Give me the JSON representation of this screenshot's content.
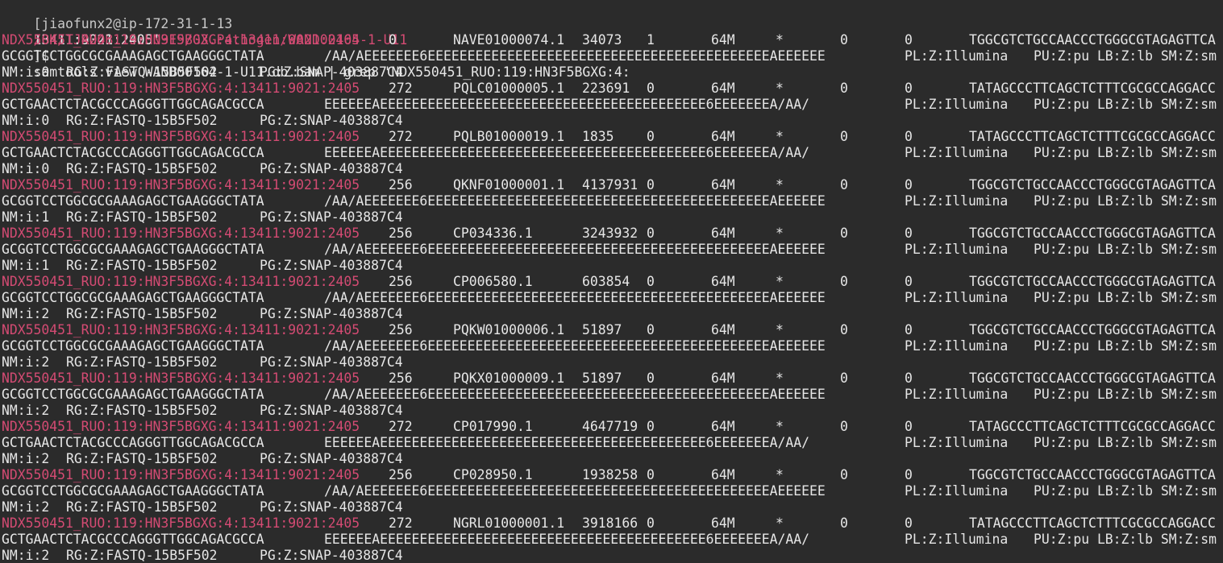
{
  "prompt": {
    "user_host": "[jiaofunx2@ip-172-31-1-13",
    "path": "/BK/TJ424B_20200919/03.Pathogen/WAND00164-1-U11",
    "suffix": "]$",
    "command_line1": "samtools view WAND00164-1-U11.db.bam | grep 'NDX550451_RUO:119:HN3F5BGXG:4:",
    "command_line2": "13411:9021:2405'"
  },
  "colors": {
    "background": "#2b2b2b",
    "text": "#e6e6e6",
    "qname": "#d44b73"
  },
  "records": [
    {
      "qname": "NDX550451_RUO:119:HN3F5BGXG:4:13411:9021:2405",
      "flag": "0",
      "rname": "NAVE01000074.1",
      "pos": "34073",
      "mapq": "1",
      "cigar": "64M",
      "rnext": "*",
      "pnext": "0",
      "tlen": "0",
      "seq_start": "TGGCGTCTGCCAACCCTGGGCGTAGAGTTCA",
      "seq_end": "GCGGTCCTGGCGCGAAAGAGCTGAAGGGCTATA",
      "qual": "/AA/AEEEEEEE6EEEEEEEEEEEEEEEEEEEEEEEEEEEEEEEEEEEEEEEEEEEAEEEEEE",
      "pl": "PL:Z:Illumina",
      "pu_lb_sm": "PU:Z:pu LB:Z:lb SM:Z:sm",
      "nm": "NM:i:0",
      "rg": "RG:Z:FASTQ-15B5F502",
      "pg": "PG:Z:SNAP-403887C4"
    },
    {
      "qname": "NDX550451_RUO:119:HN3F5BGXG:4:13411:9021:2405",
      "flag": "272",
      "rname": "PQLC01000005.1",
      "pos": "223691",
      "mapq": "0",
      "cigar": "64M",
      "rnext": "*",
      "pnext": "0",
      "tlen": "0",
      "seq_start": "TATAGCCCTTCAGCTCTTTCGCGCCAGGACC",
      "seq_end": "GCTGAACTCTACGCCCAGGGTTGGCAGACGCCA",
      "qual": "EEEEEEAEEEEEEEEEEEEEEEEEEEEEEEEEEEEEEEEEEEEEEEEE6EEEEEEEA/AA/",
      "pl": "PL:Z:Illumina",
      "pu_lb_sm": "PU:Z:pu LB:Z:lb SM:Z:sm",
      "nm": "NM:i:0",
      "rg": "RG:Z:FASTQ-15B5F502",
      "pg": "PG:Z:SNAP-403887C4"
    },
    {
      "qname": "NDX550451_RUO:119:HN3F5BGXG:4:13411:9021:2405",
      "flag": "272",
      "rname": "PQLB01000019.1",
      "pos": "1835",
      "mapq": "0",
      "cigar": "64M",
      "rnext": "*",
      "pnext": "0",
      "tlen": "0",
      "seq_start": "TATAGCCCTTCAGCTCTTTCGCGCCAGGACC",
      "seq_end": "GCTGAACTCTACGCCCAGGGTTGGCAGACGCCA",
      "qual": "EEEEEEAEEEEEEEEEEEEEEEEEEEEEEEEEEEEEEEEEEEEEEEEE6EEEEEEEA/AA/",
      "pl": "PL:Z:Illumina",
      "pu_lb_sm": "PU:Z:pu LB:Z:lb SM:Z:sm",
      "nm": "NM:i:0",
      "rg": "RG:Z:FASTQ-15B5F502",
      "pg": "PG:Z:SNAP-403887C4"
    },
    {
      "qname": "NDX550451_RUO:119:HN3F5BGXG:4:13411:9021:2405",
      "flag": "256",
      "rname": "QKNF01000001.1",
      "pos": "4137931",
      "mapq": "0",
      "cigar": "64M",
      "rnext": "*",
      "pnext": "0",
      "tlen": "0",
      "seq_start": "TGGCGTCTGCCAACCCTGGGCGTAGAGTTCA",
      "seq_end": "GCGGTCCTGGCGCGAAAGAGCTGAAGGGCTATA",
      "qual": "/AA/AEEEEEEE6EEEEEEEEEEEEEEEEEEEEEEEEEEEEEEEEEEEEEEEEEEEAEEEEEE",
      "pl": "PL:Z:Illumina",
      "pu_lb_sm": "PU:Z:pu LB:Z:lb SM:Z:sm",
      "nm": "NM:i:1",
      "rg": "RG:Z:FASTQ-15B5F502",
      "pg": "PG:Z:SNAP-403887C4"
    },
    {
      "qname": "NDX550451_RUO:119:HN3F5BGXG:4:13411:9021:2405",
      "flag": "256",
      "rname": "CP034336.1",
      "pos": "3243932",
      "mapq": "0",
      "cigar": "64M",
      "rnext": "*",
      "pnext": "0",
      "tlen": "0",
      "seq_start": "TGGCGTCTGCCAACCCTGGGCGTAGAGTTCA",
      "seq_end": "GCGGTCCTGGCGCGAAAGAGCTGAAGGGCTATA",
      "qual": "/AA/AEEEEEEE6EEEEEEEEEEEEEEEEEEEEEEEEEEEEEEEEEEEEEEEEEEEAEEEEEE",
      "pl": "PL:Z:Illumina",
      "pu_lb_sm": "PU:Z:pu LB:Z:lb SM:Z:sm",
      "nm": "NM:i:1",
      "rg": "RG:Z:FASTQ-15B5F502",
      "pg": "PG:Z:SNAP-403887C4"
    },
    {
      "qname": "NDX550451_RUO:119:HN3F5BGXG:4:13411:9021:2405",
      "flag": "256",
      "rname": "CP006580.1",
      "pos": "603854",
      "mapq": "0",
      "cigar": "64M",
      "rnext": "*",
      "pnext": "0",
      "tlen": "0",
      "seq_start": "TGGCGTCTGCCAACCCTGGGCGTAGAGTTCA",
      "seq_end": "GCGGTCCTGGCGCGAAAGAGCTGAAGGGCTATA",
      "qual": "/AA/AEEEEEEE6EEEEEEEEEEEEEEEEEEEEEEEEEEEEEEEEEEEEEEEEEEEAEEEEEE",
      "pl": "PL:Z:Illumina",
      "pu_lb_sm": "PU:Z:pu LB:Z:lb SM:Z:sm",
      "nm": "NM:i:2",
      "rg": "RG:Z:FASTQ-15B5F502",
      "pg": "PG:Z:SNAP-403887C4"
    },
    {
      "qname": "NDX550451_RUO:119:HN3F5BGXG:4:13411:9021:2405",
      "flag": "256",
      "rname": "PQKW01000006.1",
      "pos": "51897",
      "mapq": "0",
      "cigar": "64M",
      "rnext": "*",
      "pnext": "0",
      "tlen": "0",
      "seq_start": "TGGCGTCTGCCAACCCTGGGCGTAGAGTTCA",
      "seq_end": "GCGGTCCTGGCGCGAAAGAGCTGAAGGGCTATA",
      "qual": "/AA/AEEEEEEE6EEEEEEEEEEEEEEEEEEEEEEEEEEEEEEEEEEEEEEEEEEEAEEEEEE",
      "pl": "PL:Z:Illumina",
      "pu_lb_sm": "PU:Z:pu LB:Z:lb SM:Z:sm",
      "nm": "NM:i:2",
      "rg": "RG:Z:FASTQ-15B5F502",
      "pg": "PG:Z:SNAP-403887C4"
    },
    {
      "qname": "NDX550451_RUO:119:HN3F5BGXG:4:13411:9021:2405",
      "flag": "256",
      "rname": "PQKX01000009.1",
      "pos": "51897",
      "mapq": "0",
      "cigar": "64M",
      "rnext": "*",
      "pnext": "0",
      "tlen": "0",
      "seq_start": "TGGCGTCTGCCAACCCTGGGCGTAGAGTTCA",
      "seq_end": "GCGGTCCTGGCGCGAAAGAGCTGAAGGGCTATA",
      "qual": "/AA/AEEEEEEE6EEEEEEEEEEEEEEEEEEEEEEEEEEEEEEEEEEEEEEEEEEEAEEEEEE",
      "pl": "PL:Z:Illumina",
      "pu_lb_sm": "PU:Z:pu LB:Z:lb SM:Z:sm",
      "nm": "NM:i:2",
      "rg": "RG:Z:FASTQ-15B5F502",
      "pg": "PG:Z:SNAP-403887C4"
    },
    {
      "qname": "NDX550451_RUO:119:HN3F5BGXG:4:13411:9021:2405",
      "flag": "272",
      "rname": "CP017990.1",
      "pos": "4647719",
      "mapq": "0",
      "cigar": "64M",
      "rnext": "*",
      "pnext": "0",
      "tlen": "0",
      "seq_start": "TATAGCCCTTCAGCTCTTTCGCGCCAGGACC",
      "seq_end": "GCTGAACTCTACGCCCAGGGTTGGCAGACGCCA",
      "qual": "EEEEEEAEEEEEEEEEEEEEEEEEEEEEEEEEEEEEEEEEEEEEEEEE6EEEEEEEA/AA/",
      "pl": "PL:Z:Illumina",
      "pu_lb_sm": "PU:Z:pu LB:Z:lb SM:Z:sm",
      "nm": "NM:i:2",
      "rg": "RG:Z:FASTQ-15B5F502",
      "pg": "PG:Z:SNAP-403887C4"
    },
    {
      "qname": "NDX550451_RUO:119:HN3F5BGXG:4:13411:9021:2405",
      "flag": "256",
      "rname": "CP028950.1",
      "pos": "1938258",
      "mapq": "0",
      "cigar": "64M",
      "rnext": "*",
      "pnext": "0",
      "tlen": "0",
      "seq_start": "TGGCGTCTGCCAACCCTGGGCGTAGAGTTCA",
      "seq_end": "GCGGTCCTGGCGCGAAAGAGCTGAAGGGCTATA",
      "qual": "/AA/AEEEEEEE6EEEEEEEEEEEEEEEEEEEEEEEEEEEEEEEEEEEEEEEEEEEAEEEEEE",
      "pl": "PL:Z:Illumina",
      "pu_lb_sm": "PU:Z:pu LB:Z:lb SM:Z:sm",
      "nm": "NM:i:2",
      "rg": "RG:Z:FASTQ-15B5F502",
      "pg": "PG:Z:SNAP-403887C4"
    },
    {
      "qname": "NDX550451_RUO:119:HN3F5BGXG:4:13411:9021:2405",
      "flag": "272",
      "rname": "NGRL01000001.1",
      "pos": "3918166",
      "mapq": "0",
      "cigar": "64M",
      "rnext": "*",
      "pnext": "0",
      "tlen": "0",
      "seq_start": "TATAGCCCTTCAGCTCTTTCGCGCCAGGACC",
      "seq_end": "GCTGAACTCTACGCCCAGGGTTGGCAGACGCCA",
      "qual": "EEEEEEAEEEEEEEEEEEEEEEEEEEEEEEEEEEEEEEEEEEEEEEEE6EEEEEEEA/AA/",
      "pl": "PL:Z:Illumina",
      "pu_lb_sm": "PU:Z:pu LB:Z:lb SM:Z:sm",
      "nm": "NM:i:2",
      "rg": "RG:Z:FASTQ-15B5F502",
      "pg": "PG:Z:SNAP-403887C4"
    }
  ]
}
